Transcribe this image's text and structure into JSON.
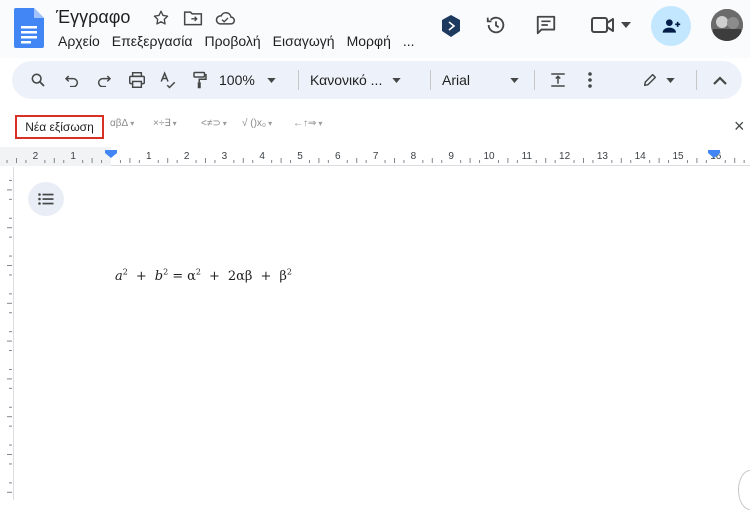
{
  "app": {
    "doc_title": "Έγγραφο",
    "menu": [
      "Αρχείο",
      "Επεξεργασία",
      "Προβολή",
      "Εισαγωγή",
      "Μορφή",
      "..."
    ]
  },
  "toolbar": {
    "zoom": "100%",
    "style": "Κανονικό ...",
    "font": "Arial"
  },
  "equation_toolbar": {
    "new_equation": "Νέα εξίσωση",
    "groups": [
      "αβΔ",
      "×÷∃",
      "<≠⊃",
      "√ ()x₀",
      "←↑⇒"
    ],
    "close": "×"
  },
  "ruler": {
    "left_labels": [
      "2",
      "1"
    ],
    "labels": [
      "1",
      "2",
      "3",
      "4",
      "5",
      "6",
      "7",
      "8",
      "9",
      "10",
      "11",
      "12",
      "13",
      "14",
      "15",
      "16"
    ]
  },
  "document": {
    "equation": {
      "parts": [
        {
          "base": "a",
          "exp": "2",
          "italic": true
        },
        {
          "op": "+"
        },
        {
          "base": "b",
          "exp": "2",
          "italic": true
        },
        {
          "op": "="
        },
        {
          "base": "α",
          "exp": "2",
          "italic": false
        },
        {
          "op": "+"
        },
        {
          "term": "2αβ"
        },
        {
          "op": "+"
        },
        {
          "base": "β",
          "exp": "2",
          "italic": false
        }
      ]
    }
  },
  "colors": {
    "accent_blue": "#4285f4",
    "share_bg": "#c2e7ff",
    "highlight_red": "#d93025",
    "toolbar_bg": "#edf2fa"
  }
}
